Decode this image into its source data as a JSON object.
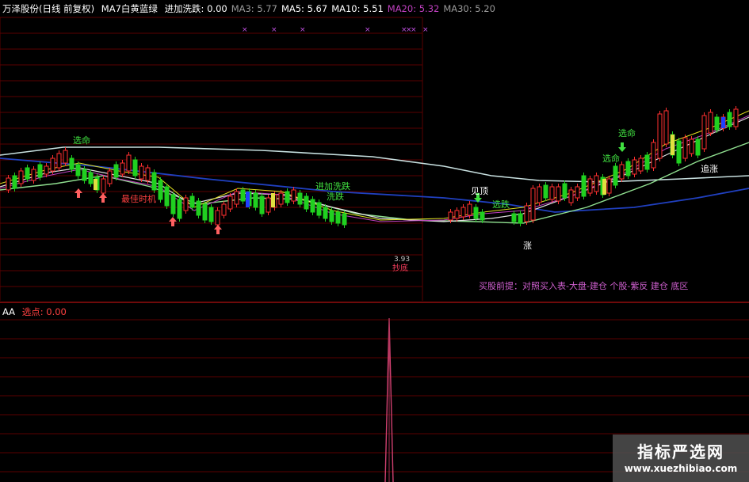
{
  "header": {
    "stock_name": "万泽股份(日线 前复权)",
    "indicator_name": "MA7白黄蓝绿",
    "items": [
      {
        "label": "进加洗跌:",
        "value": "0.00",
        "color": "#ffffff"
      },
      {
        "label": "MA3:",
        "value": "5.77",
        "color": "#9a9a9a"
      },
      {
        "label": "MA5:",
        "value": "5.67",
        "color": "#ffffff"
      },
      {
        "label": "MA10:",
        "value": "5.51",
        "color": "#ffffff"
      },
      {
        "label": "MA20:",
        "value": "5.32",
        "color": "#c040c0"
      },
      {
        "label": "MA30:",
        "value": "5.20",
        "color": "#9a9a9a"
      }
    ]
  },
  "sub_header": {
    "indicator": "AA",
    "label": "选点:",
    "value": "0.00"
  },
  "annotations": {
    "xuanming_1": "选命",
    "xuanming_2": "选命",
    "xuanming_3": "选命",
    "zuijia_shiji": "最佳时机",
    "jinjia_xidie": "进加洗跌",
    "xidie": "洗跌",
    "guding": "见顶",
    "xuandie": "选跌",
    "zhuizhang": "追涨",
    "zhang": "涨",
    "price_low": "3.93",
    "low_marker": "抄底",
    "note": "买股前提：对照买入表-大盘-建仓  个股-紫反 建仓 底区"
  },
  "watermark": {
    "title": "指标严选网",
    "url": "www.xuezhibiao.com"
  },
  "colors": {
    "up": "#ff3030",
    "down": "#20d020",
    "grid": "#8b0000",
    "spike": "#d04070"
  }
}
